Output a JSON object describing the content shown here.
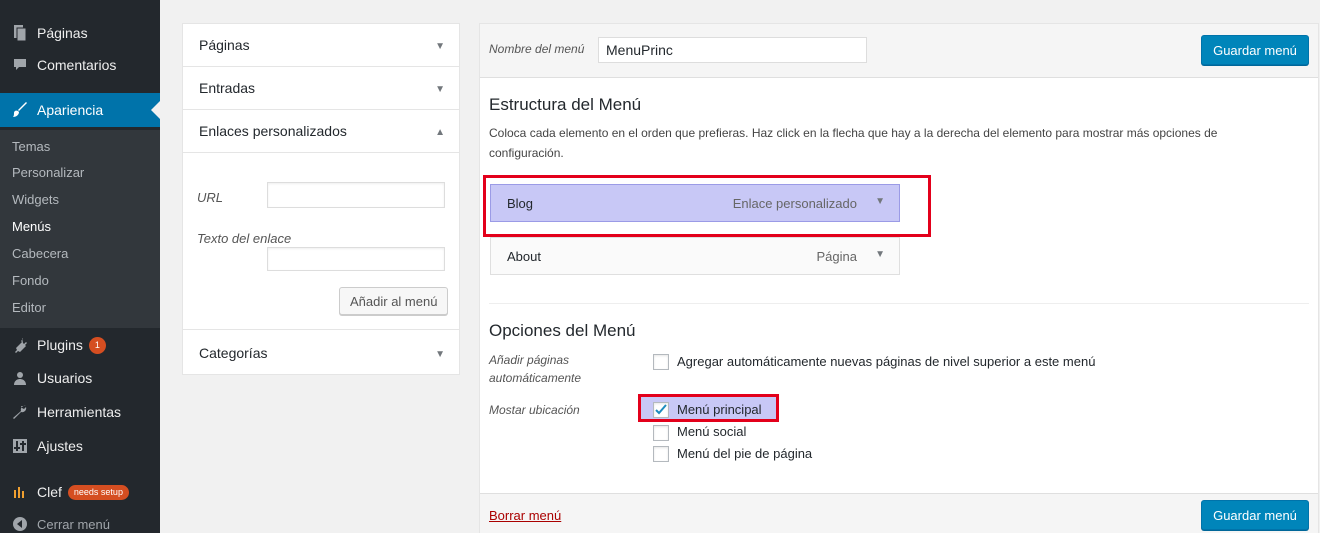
{
  "sidebar": {
    "items": [
      {
        "label": "Páginas",
        "icon": "pages-icon"
      },
      {
        "label": "Comentarios",
        "icon": "comments-icon"
      },
      {
        "label": "Apariencia",
        "icon": "brush-icon"
      },
      {
        "label": "Plugins",
        "icon": "plug-icon",
        "badge": "1"
      },
      {
        "label": "Usuarios",
        "icon": "users-icon"
      },
      {
        "label": "Herramientas",
        "icon": "wrench-icon"
      },
      {
        "label": "Ajustes",
        "icon": "settings-icon"
      },
      {
        "label": "Clef",
        "icon": "clef-logo-icon",
        "badge": "needs setup"
      },
      {
        "label": "Cerrar menú",
        "icon": "collapse-icon"
      }
    ],
    "submenu": [
      "Temas",
      "Personalizar",
      "Widgets",
      "Menús",
      "Cabecera",
      "Fondo",
      "Editor"
    ],
    "current_sub": "Menús"
  },
  "accordion": {
    "sections": [
      {
        "title": "Páginas"
      },
      {
        "title": "Entradas"
      },
      {
        "title": "Enlaces personalizados"
      },
      {
        "title": "Categorías"
      }
    ],
    "custom_links": {
      "url_label": "URL",
      "url_value": "",
      "text_label": "Texto del enlace",
      "text_value": "",
      "add_button": "Añadir al menú"
    }
  },
  "editor": {
    "menu_name_label": "Nombre del menú",
    "menu_name_value": "MenuPrinc",
    "save_button": "Guardar menú",
    "structure_title": "Estructura del Menú",
    "structure_desc": "Coloca cada elemento en el orden que prefieras. Haz click en la flecha que hay a la derecha del elemento para mostrar más opciones de configuración.",
    "menu_items": [
      {
        "title": "Blog",
        "type": "Enlace personalizado",
        "highlighted": true
      },
      {
        "title": "About",
        "type": "Página",
        "highlighted": false
      }
    ],
    "options_title": "Opciones del Menú",
    "auto_add_label": "Añadir páginas automáticamente",
    "auto_add_option": "Agregar automáticamente nuevas páginas de nivel superior a este menú",
    "auto_add_checked": false,
    "locations_label": "Mostar ubicación",
    "locations": [
      {
        "label": "Menú principal",
        "checked": true
      },
      {
        "label": "Menú social",
        "checked": false
      },
      {
        "label": "Menú del pie de página",
        "checked": false
      }
    ],
    "delete_link": "Borrar menú",
    "save_button_bottom": "Guardar menú"
  },
  "colors": {
    "sidebar_bg": "#23282d",
    "accent": "#0073aa",
    "primary_button": "#0085ba",
    "highlight": "#c8c8f6",
    "annotation_red": "#e3001b",
    "delete_link": "#aa0000"
  }
}
